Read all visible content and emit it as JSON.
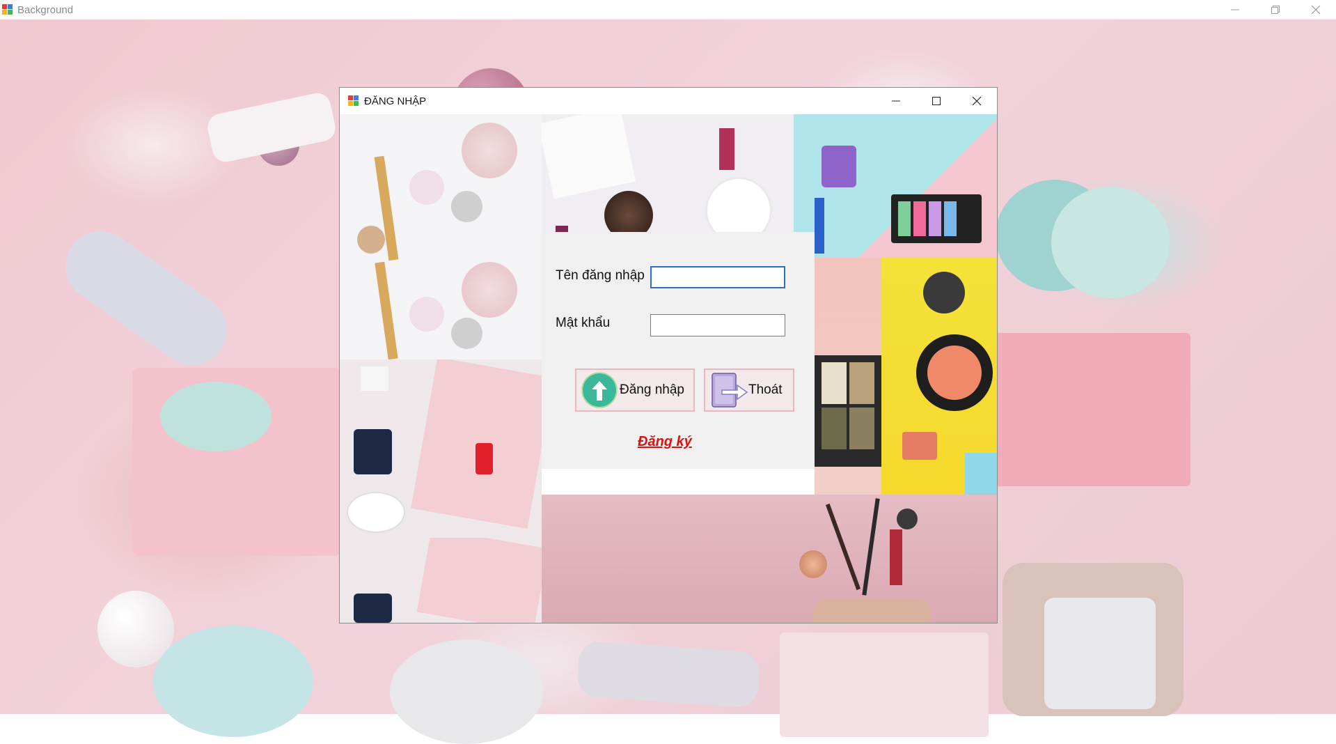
{
  "outer_window": {
    "title": "Background"
  },
  "login_window": {
    "title": "ĐĂNG NHẬP"
  },
  "form": {
    "username_label": "Tên đăng nhập",
    "username_value": "",
    "password_label": "Mật khẩu",
    "password_value": "",
    "login_button_label": "Đăng nhập",
    "exit_button_label": "Thoát",
    "register_link": "Đăng ký"
  },
  "colors": {
    "link": "#e01010",
    "input_focus": "#2a6fc4",
    "button_border": "#e8b7bf",
    "login_icon": "#3bb79a"
  },
  "icons": {
    "app": "app-icon",
    "login": "arrow-up-circle-icon",
    "exit": "door-exit-icon"
  }
}
